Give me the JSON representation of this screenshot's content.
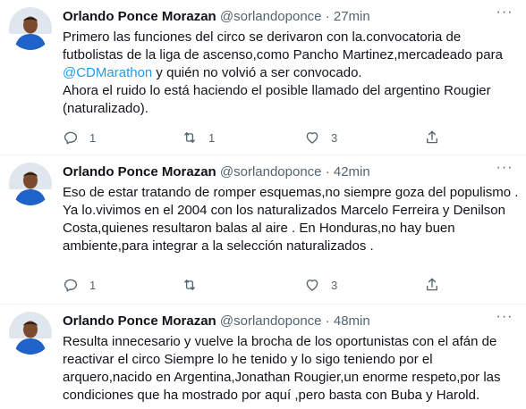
{
  "tweets": [
    {
      "name": "Orlando Ponce Morazan",
      "handle": "@sorlandoponce",
      "separator": "·",
      "time": "27min",
      "text_before_mention": "Primero las funciones del circo se  derivaron con la.convocatoria de futbolistas de la liga de ascenso,como Pancho Martinez,mercadeado para ",
      "mention": "@CDMarathon",
      "text_after_mention": " y quién no volvió a ser convocado.",
      "text_para2": "Ahora  el ruido lo está haciendo el posible llamado del argentino Rougier (naturalizado).",
      "replies": "1",
      "retweets": "1",
      "likes": "3"
    },
    {
      "name": "Orlando Ponce Morazan",
      "handle": "@sorlandoponce",
      "separator": "·",
      "time": "42min",
      "text": "Eso de estar tratando de romper esquemas,no siempre goza del populismo . Ya lo.vivimos en el 2004 con los naturalizados Marcelo Ferreira y Denilson Costa,quienes resultaron balas al aire . En Honduras,no hay buen ambiente,para integrar a la selección naturalizados .",
      "replies": "1",
      "retweets": "",
      "likes": "3"
    },
    {
      "name": "Orlando Ponce Morazan",
      "handle": "@sorlandoponce",
      "separator": "·",
      "time": "48min",
      "text": "Resulta innecesario y vuelve la brocha de los oportunistas con el afán de reactivar el circo  Siempre lo he tenido y lo sigo teniendo por el arquero,nacido en Argentina,Jonathan Rougier,un enorme respeto,por las condiciones que ha mostrado por aquí ,pero basta con Buba y Harold."
    }
  ],
  "more_glyph": "···",
  "colors": {
    "accent": "#1d9bf0",
    "secondary": "#536471",
    "text": "#0f1419"
  }
}
